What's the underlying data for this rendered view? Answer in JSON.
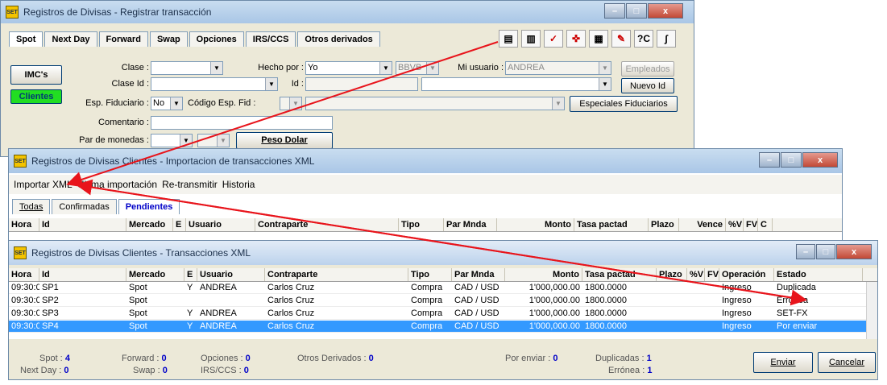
{
  "win1": {
    "title": "Registros de Divisas - Registrar transacción",
    "tabs": [
      "Spot",
      "Next Day",
      "Forward",
      "Swap",
      "Opciones",
      "IRS/CCS",
      "Otros derivados"
    ],
    "imc_label": "IMC's",
    "clientes_label": "Clientes",
    "clase_label": "Clase :",
    "clase_id_label": "Clase Id :",
    "esp_fid_label": "Esp. Fiduciario :",
    "esp_fid_value": "No",
    "codigo_label": "Código Esp. Fid :",
    "comentario_label": "Comentario :",
    "par_label": "Par de monedas :",
    "hecho_label": "Hecho por :",
    "hecho_value": "Yo",
    "bank_value": "BBVB",
    "id_label": "Id :",
    "usuario_label": "Mi usuario :",
    "usuario_value": "ANDREA",
    "empleados_label": "Empleados",
    "nuevo_id_label": "Nuevo Id",
    "especiales_label": "Especiales Fiduciarios",
    "peso_label": "Peso Dolar",
    "toolbar_icons": [
      "import-xml-icon",
      "document-icon",
      "check-icon",
      "transfer-icon",
      "calculator-icon",
      "report-icon",
      "currency-icon",
      "settings-icon"
    ]
  },
  "win2": {
    "title": "Registros de Divisas Clientes - Importacion de transacciones XML",
    "menu": [
      "Importar XML",
      "Ultima importación",
      "Re-transmitir",
      "Historia"
    ],
    "tabs": [
      "Todas",
      "Confirmadas",
      "Pendientes"
    ],
    "headers": [
      "Hora",
      "Id",
      "Mercado",
      "E",
      "Usuario",
      "Contraparte",
      "Tipo",
      "Par Mnda",
      "Monto",
      "Tasa pactad",
      "Plazo",
      "Vence",
      "%V",
      "FV",
      "C"
    ]
  },
  "win3": {
    "title": "Registros de Divisas Clientes - Transacciones XML",
    "headers": [
      "Hora",
      "Id",
      "Mercado",
      "E",
      "Usuario",
      "Contraparte",
      "Tipo",
      "Par Mnda",
      "Monto",
      "Tasa pactad",
      "Plazo",
      "%V",
      "FV",
      "Operación",
      "Estado"
    ],
    "rows": [
      {
        "hora": "09:30:00",
        "id": "SP1",
        "mercado": "Spot",
        "e": "Y",
        "usuario": "ANDREA",
        "contraparte": "Carlos Cruz",
        "tipo": "Compra",
        "par": "CAD / USD",
        "monto": "1'000,000.00",
        "tasa": "1800.0000",
        "operacion": "Ingreso",
        "estado": "Duplicada"
      },
      {
        "hora": "09:30:00",
        "id": "SP2",
        "mercado": "Spot",
        "e": "",
        "usuario": "",
        "contraparte": "Carlos Cruz",
        "tipo": "Compra",
        "par": "CAD / USD",
        "monto": "1'000,000.00",
        "tasa": "1800.0000",
        "operacion": "Ingreso",
        "estado": "Errónea"
      },
      {
        "hora": "09:30:00",
        "id": "SP3",
        "mercado": "Spot",
        "e": "Y",
        "usuario": "ANDREA",
        "contraparte": "Carlos Cruz",
        "tipo": "Compra",
        "par": "CAD / USD",
        "monto": "1'000,000.00",
        "tasa": "1800.0000",
        "operacion": "Ingreso",
        "estado": "SET-FX"
      },
      {
        "hora": "09:30:00",
        "id": "SP4",
        "mercado": "Spot",
        "e": "Y",
        "usuario": "ANDREA",
        "contraparte": "Carlos Cruz",
        "tipo": "Compra",
        "par": "CAD / USD",
        "monto": "1'000,000.00",
        "tasa": "1800.0000",
        "operacion": "Ingreso",
        "estado": "Por enviar"
      }
    ],
    "footer": {
      "spot_label": "Spot :",
      "spot_value": "4",
      "nextday_label": "Next Day :",
      "nextday_value": "0",
      "forward_label": "Forward :",
      "forward_value": "0",
      "swap_label": "Swap :",
      "swap_value": "0",
      "opciones_label": "Opciones :",
      "opciones_value": "0",
      "irs_label": "IRS/CCS :",
      "irs_value": "0",
      "otros_label": "Otros Derivados :",
      "otros_value": "0",
      "porenviar_label": "Por enviar :",
      "porenviar_value": "0",
      "duplicadas_label": "Duplicadas :",
      "duplicadas_value": "1",
      "erronea_label": "Errónea :",
      "erronea_value": "1"
    },
    "enviar_label": "Enviar",
    "cancelar_label": "Cancelar"
  },
  "colors": {
    "arrow": "#e8141b",
    "selected_row": "#3399ff",
    "clientes_btn": "#22dd22",
    "count": "#0000c8"
  }
}
